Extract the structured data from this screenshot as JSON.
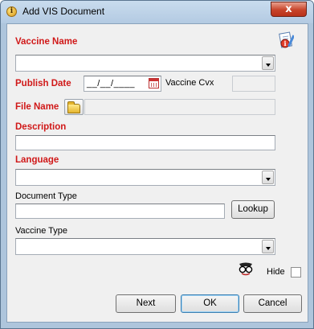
{
  "window": {
    "title": "Add VIS Document",
    "close_glyph": "x",
    "title_icon_glyph": "i"
  },
  "icons": {
    "title": "info-icon",
    "close": "close-icon",
    "document_info": "document-info-icon",
    "calendar": "calendar-icon",
    "folder": "open-folder-icon",
    "hide": "hide-glasses-icon"
  },
  "form": {
    "vaccine_name": {
      "label": "Vaccine Name",
      "value": ""
    },
    "publish_date": {
      "label": "Publish Date",
      "value": "__/__/____"
    },
    "vaccine_cvx": {
      "label": "Vaccine Cvx",
      "value": ""
    },
    "file_name": {
      "label": "File Name",
      "value": ""
    },
    "description": {
      "label": "Description",
      "value": ""
    },
    "language": {
      "label": "Language",
      "value": ""
    },
    "document_type": {
      "label": "Document Type",
      "value": "",
      "lookup_label": "Lookup"
    },
    "vaccine_type": {
      "label": "Vaccine Type",
      "value": ""
    },
    "hide": {
      "label": "Hide",
      "checked": false
    }
  },
  "buttons": {
    "next": "Next",
    "ok": "OK",
    "cancel": "Cancel"
  },
  "colors": {
    "required_label": "#d01818",
    "window_frame": "#aec5dc",
    "client_bg": "#f0f0f0"
  }
}
